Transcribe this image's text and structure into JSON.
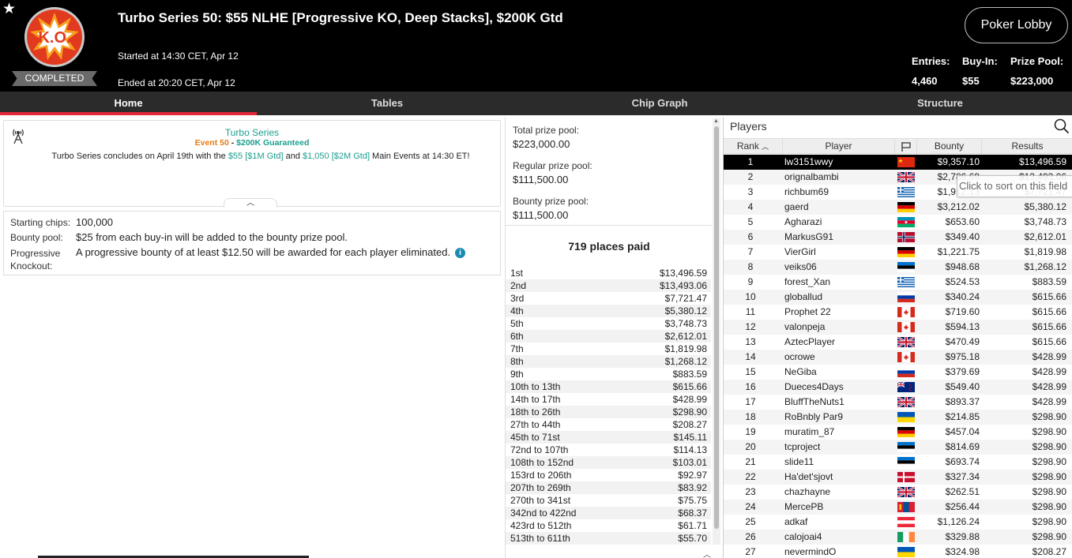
{
  "header": {
    "title": "Turbo Series 50: $55 NLHE [Progressive KO, Deep Stacks], $200K Gtd",
    "started": "Started at 14:30 CET, Apr 12",
    "ended": "Ended at 20:20 CET, Apr 12",
    "status": "COMPLETED",
    "logo_text": "K.O.",
    "lobby_button": "Poker Lobby",
    "stats": {
      "entries_label": "Entries:",
      "entries_value": "4,460",
      "buyin_label": "Buy-In:",
      "buyin_value": "$55",
      "prizepool_label": "Prize Pool:",
      "prizepool_value": "$223,000"
    }
  },
  "tabs": [
    {
      "label": "Home",
      "active": true
    },
    {
      "label": "Tables",
      "active": false
    },
    {
      "label": "Chip Graph",
      "active": false
    },
    {
      "label": "Structure",
      "active": false
    }
  ],
  "info": {
    "series": "Turbo Series",
    "event": "Event 50",
    "separator": " - ",
    "guarantee": "$200K Guaranteed",
    "desc_1": "Turbo Series concludes on April 19th with the ",
    "link_1": "$55 [$1M Gtd]",
    "desc_2": " and ",
    "link_2": "$1,050 [$2M Gtd]",
    "desc_3": " Main Events at 14:30 ET!"
  },
  "details": {
    "starting_label": "Starting chips:",
    "starting_value": "100,000",
    "bounty_label": "Bounty pool:",
    "bounty_value": "$25 from each buy-in will be added to the bounty prize pool.",
    "pko_label": "Progressive Knockout:",
    "pko_value": "A progressive bounty of at least $12.50 will be awarded for each player eliminated."
  },
  "prize": {
    "total_label": "Total prize pool:",
    "total_value": "$223,000.00",
    "regular_label": "Regular prize pool:",
    "regular_value": "$111,500.00",
    "bounty_label": "Bounty prize pool:",
    "bounty_value": "$111,500.00",
    "places_paid": "719 places paid",
    "payouts": [
      [
        "1st",
        "$13,496.59"
      ],
      [
        "2nd",
        "$13,493.06"
      ],
      [
        "3rd",
        "$7,721.47"
      ],
      [
        "4th",
        "$5,380.12"
      ],
      [
        "5th",
        "$3,748.73"
      ],
      [
        "6th",
        "$2,612.01"
      ],
      [
        "7th",
        "$1,819.98"
      ],
      [
        "8th",
        "$1,268.12"
      ],
      [
        "9th",
        "$883.59"
      ],
      [
        "10th to 13th",
        "$615.66"
      ],
      [
        "14th to 17th",
        "$428.99"
      ],
      [
        "18th to 26th",
        "$298.90"
      ],
      [
        "27th to 44th",
        "$208.27"
      ],
      [
        "45th to 71st",
        "$145.11"
      ],
      [
        "72nd to 107th",
        "$114.13"
      ],
      [
        "108th to 152nd",
        "$103.01"
      ],
      [
        "153rd to 206th",
        "$92.97"
      ],
      [
        "207th to 269th",
        "$83.92"
      ],
      [
        "270th to 341st",
        "$75.75"
      ],
      [
        "342nd to 422nd",
        "$68.37"
      ],
      [
        "423rd to 512th",
        "$61.71"
      ],
      [
        "513th to 611th",
        "$55.70"
      ]
    ]
  },
  "players": {
    "title": "Players",
    "columns": [
      "Rank",
      "Player",
      "Bounty",
      "Results"
    ],
    "tooltip": "Click to sort on this field",
    "rows": [
      {
        "rank": "1",
        "name": "lw3151wwy",
        "flag": "cn",
        "bounty": "$9,357.10",
        "result": "$13,496.59",
        "selected": true
      },
      {
        "rank": "2",
        "name": "orignalbambi",
        "flag": "gb",
        "bounty": "$2,786.69",
        "result": "$13,493.06"
      },
      {
        "rank": "3",
        "name": "richbum69",
        "flag": "gr",
        "bounty": "$1,912.13",
        "result": "$7,721.47"
      },
      {
        "rank": "4",
        "name": "gaerd",
        "flag": "de",
        "bounty": "$3,212.02",
        "result": "$5,380.12"
      },
      {
        "rank": "5",
        "name": "Agharazi",
        "flag": "az",
        "bounty": "$653.60",
        "result": "$3,748.73"
      },
      {
        "rank": "6",
        "name": "MarkusG91",
        "flag": "no",
        "bounty": "$349.40",
        "result": "$2,612.01"
      },
      {
        "rank": "7",
        "name": "VierGirl",
        "flag": "de",
        "bounty": "$1,221.75",
        "result": "$1,819.98"
      },
      {
        "rank": "8",
        "name": "veiks06",
        "flag": "ee",
        "bounty": "$948.68",
        "result": "$1,268.12"
      },
      {
        "rank": "9",
        "name": "forest_Xan",
        "flag": "gr",
        "bounty": "$524.53",
        "result": "$883.59"
      },
      {
        "rank": "10",
        "name": "globallud",
        "flag": "ru",
        "bounty": "$340.24",
        "result": "$615.66"
      },
      {
        "rank": "11",
        "name": "Prophet 22",
        "flag": "ca",
        "bounty": "$719.60",
        "result": "$615.66"
      },
      {
        "rank": "12",
        "name": "valonpeja",
        "flag": "ca",
        "bounty": "$594.13",
        "result": "$615.66"
      },
      {
        "rank": "13",
        "name": "AztecPlayer",
        "flag": "gb",
        "bounty": "$470.49",
        "result": "$615.66"
      },
      {
        "rank": "14",
        "name": "ocrowe",
        "flag": "ca",
        "bounty": "$975.18",
        "result": "$428.99"
      },
      {
        "rank": "15",
        "name": "NeGiba",
        "flag": "ru",
        "bounty": "$379.69",
        "result": "$428.99"
      },
      {
        "rank": "16",
        "name": "Dueces4Days",
        "flag": "nz",
        "bounty": "$549.40",
        "result": "$428.99"
      },
      {
        "rank": "17",
        "name": "BluffTheNuts1",
        "flag": "gb",
        "bounty": "$893.37",
        "result": "$428.99"
      },
      {
        "rank": "18",
        "name": "RoBnbly Par9",
        "flag": "ua",
        "bounty": "$214.85",
        "result": "$298.90"
      },
      {
        "rank": "19",
        "name": "muratim_87",
        "flag": "de",
        "bounty": "$457.04",
        "result": "$298.90"
      },
      {
        "rank": "20",
        "name": "tcproject",
        "flag": "ee",
        "bounty": "$814.69",
        "result": "$298.90"
      },
      {
        "rank": "21",
        "name": "slide11",
        "flag": "ee",
        "bounty": "$693.74",
        "result": "$298.90"
      },
      {
        "rank": "22",
        "name": "Ha'det'sjovt",
        "flag": "dk",
        "bounty": "$327.34",
        "result": "$298.90"
      },
      {
        "rank": "23",
        "name": "chazhayne",
        "flag": "gb",
        "bounty": "$262.51",
        "result": "$298.90"
      },
      {
        "rank": "24",
        "name": "MercePB",
        "flag": "mn",
        "bounty": "$256.44",
        "result": "$298.90"
      },
      {
        "rank": "25",
        "name": "adkaf",
        "flag": "at",
        "bounty": "$1,126.24",
        "result": "$298.90"
      },
      {
        "rank": "26",
        "name": "calojoai4",
        "flag": "ie",
        "bounty": "$329.88",
        "result": "$298.90"
      },
      {
        "rank": "27",
        "name": "nevermindO",
        "flag": "ua",
        "bounty": "$324.98",
        "result": "$208.27"
      }
    ]
  },
  "colors": {
    "accent_red": "#e0283a",
    "link_teal": "#1a9e8e",
    "event_orange": "#e87b16"
  }
}
